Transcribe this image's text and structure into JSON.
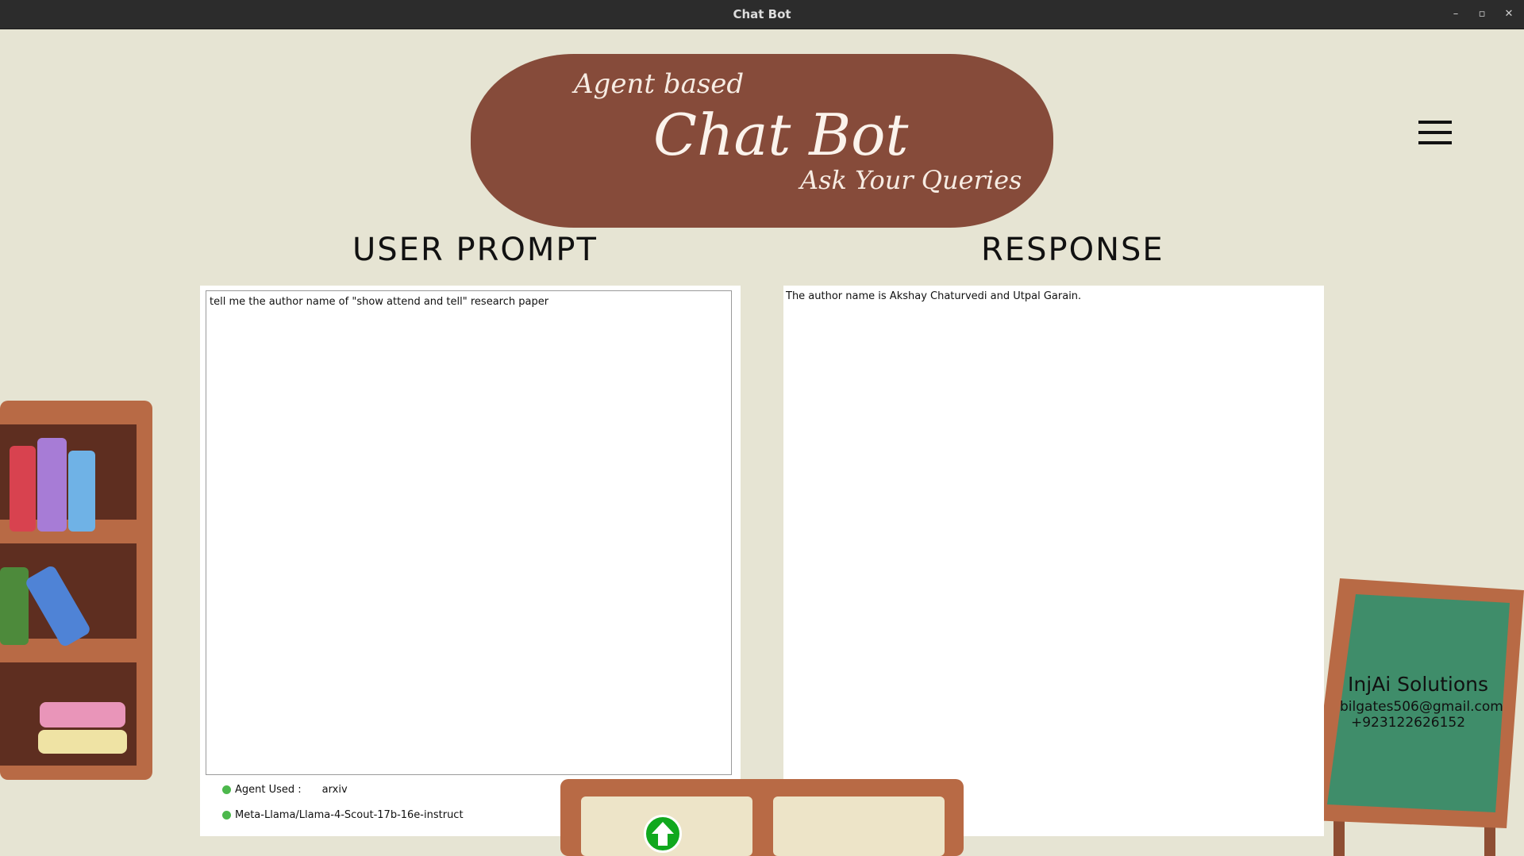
{
  "window": {
    "title": "Chat Bot",
    "minimize": "–",
    "restore": "▫",
    "close": "✕"
  },
  "banner": {
    "line1": "Agent based",
    "line2": "Chat Bot",
    "line3": "Ask Your Queries"
  },
  "headings": {
    "prompt": "USER PROMPT",
    "response": "RESPONSE"
  },
  "prompt": {
    "value": "tell me the author name of \"show attend and tell\" research paper"
  },
  "response": {
    "text": "The author name is Akshay Chaturvedi and Utpal Garain."
  },
  "status": {
    "agent_label": "Agent Used :",
    "agent_value": "arxiv",
    "model": "Meta-Llama/Llama-4-Scout-17b-16e-instruct"
  },
  "contact": {
    "company": "InjAi Solutions",
    "email": "bilgates506@gmail.com",
    "phone": "+923122626152"
  },
  "icons": {
    "menu": "hamburger-menu-icon",
    "send": "arrow-up-icon"
  },
  "colors": {
    "background": "#e6e4d3",
    "banner": "#864b3a",
    "send_button": "#10a81e",
    "board": "#3f8d6a",
    "wood": "#b86a45"
  }
}
